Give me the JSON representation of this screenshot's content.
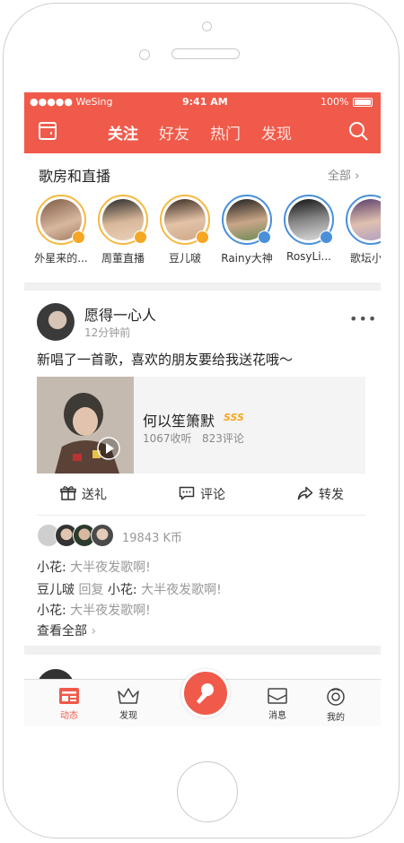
{
  "status_bar": {
    "carrier": "●●●●● WeSing",
    "time": "9:41 AM",
    "battery": "100%"
  },
  "header": {
    "tabs": [
      {
        "label": "关注",
        "active": true
      },
      {
        "label": "好友",
        "active": false
      },
      {
        "label": "热门",
        "active": false
      },
      {
        "label": "发现",
        "active": false
      }
    ],
    "left_icon": "room-icon",
    "right_icon": "search-icon"
  },
  "live_section": {
    "title": "歌房和直播",
    "all_label": "全部",
    "items": [
      {
        "name": "外星来的...",
        "ring": "#f5b942",
        "badge": "video"
      },
      {
        "name": "周董直播",
        "ring": "#f5b942",
        "badge": "video"
      },
      {
        "name": "豆儿啵",
        "ring": "#f5b942",
        "badge": "video"
      },
      {
        "name": "Rainy大神",
        "ring": "#4a90d9",
        "badge": "room"
      },
      {
        "name": "RosyLi...",
        "ring": "#4a90d9",
        "badge": "room"
      },
      {
        "name": "歌坛小M",
        "ring": "#4a90d9",
        "badge": "room"
      }
    ]
  },
  "post": {
    "user": "愿得一心人",
    "time": "12分钟前",
    "text": "新唱了一首歌，喜欢的朋友要给我送花哦～",
    "song": {
      "title": "何以笙箫默",
      "badge": "SSS",
      "plays": "1067收听",
      "comments": "823评论"
    },
    "actions": {
      "gift": "送礼",
      "comment": "评论",
      "share": "转发"
    },
    "gift_total": "19843 K币",
    "comments": [
      {
        "user": "小花:",
        "reply": "",
        "reply_to": "",
        "text": "大半夜发歌啊!"
      },
      {
        "user": "豆儿啵",
        "reply": "回复",
        "reply_to": "小花:",
        "text": "大半夜发歌啊!"
      },
      {
        "user": "小花:",
        "reply": "",
        "reply_to": "",
        "text": "大半夜发歌啊!"
      }
    ],
    "view_all": "查看全部"
  },
  "bottom_nav": [
    {
      "label": "动态",
      "active": true
    },
    {
      "label": "发现",
      "active": false
    },
    {
      "label": "消息",
      "active": false
    },
    {
      "label": "我的",
      "active": false
    }
  ],
  "colors": {
    "accent": "#f05a4a",
    "gold": "#f5b942",
    "blue": "#4a90d9"
  }
}
